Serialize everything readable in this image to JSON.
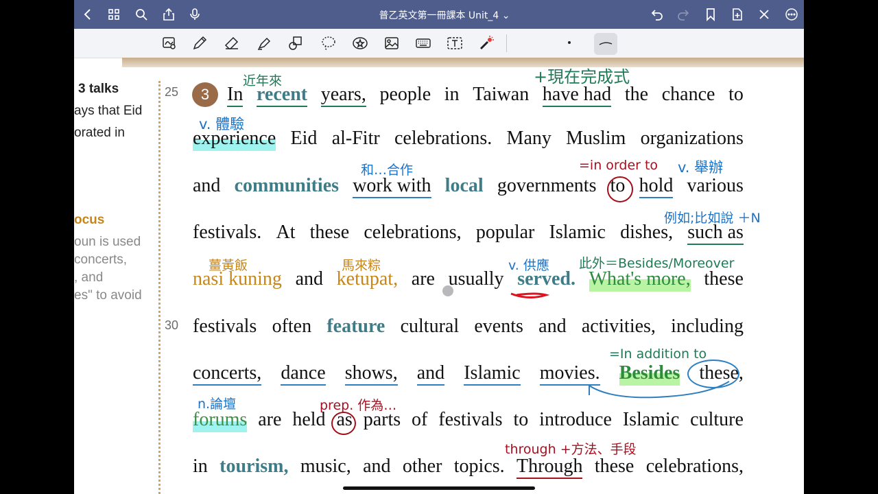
{
  "titlebar": {
    "doc_title": "普乙英文第一冊課本 Unit_4 ⌄"
  },
  "sidebar": {
    "lines": [
      "3 talks",
      "ays that Eid",
      "orated in",
      "ocus",
      "oun is used",
      "concerts,",
      ", and",
      "es\" to avoid"
    ]
  },
  "line_numbers": [
    "25",
    "30"
  ],
  "paragraph_number": "3",
  "text": {
    "l1": [
      "In",
      "recent",
      "years,",
      "people",
      "in",
      "Taiwan",
      "have had",
      "the",
      "chance",
      "to"
    ],
    "l2": [
      "experience",
      "Eid",
      "al-Fitr",
      "celebrations.",
      "Many",
      "Muslim",
      "organizations"
    ],
    "l3": [
      "and",
      "communities",
      "work with",
      "local",
      "governments",
      "to",
      "hold",
      "various"
    ],
    "l4": [
      "festivals.",
      "At",
      "these",
      "celebrations,",
      "popular",
      "Islamic",
      "dishes,",
      "such as"
    ],
    "l5": [
      "nasi kuning",
      "and",
      "ketupat,",
      "are",
      "usually",
      "served.",
      "What's more,",
      "these"
    ],
    "l6": [
      "festivals",
      "often",
      "feature",
      "cultural",
      "events",
      "and",
      "activities,",
      "including"
    ],
    "l7": [
      "concerts,",
      "dance",
      "shows,",
      "and",
      "Islamic",
      "movies.",
      "Besides",
      "these,"
    ],
    "l8": [
      "forums",
      "are",
      "held",
      "as",
      "parts",
      "of",
      "festivals",
      "to",
      "introduce",
      "Islamic",
      "culture"
    ],
    "l9": [
      "in",
      "tourism,",
      "music,",
      "and",
      "other",
      "topics.",
      "Through",
      "these",
      "celebrations,"
    ]
  },
  "annotations": {
    "a1": "近年來",
    "a2": "+現在完成式",
    "a3": "v. 體驗",
    "a4": "和…合作",
    "a5": "=in order to",
    "a6": "v. 舉辦",
    "a7": "例如;比如說 ＋N",
    "a8": "薑黃飯",
    "a9": "馬來粽",
    "a10": "v. 供應",
    "a11": "此外＝Besides/Moreover",
    "a12": "=In addition to",
    "a13": "n.論壇",
    "a14": "prep. 作為…",
    "a15": "through +方法、手段"
  }
}
